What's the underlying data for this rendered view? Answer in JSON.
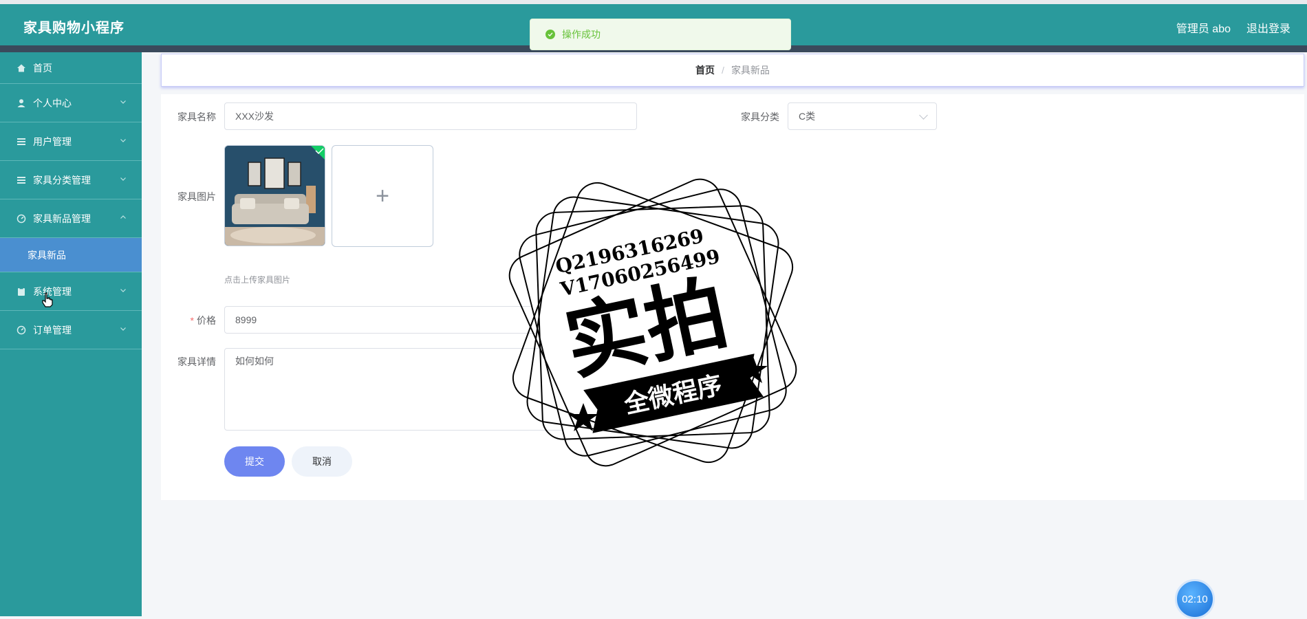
{
  "header": {
    "app_title": "家具购物小程序",
    "admin_label": "管理员 abo",
    "logout_label": "退出登录"
  },
  "toast": {
    "message": "操作成功",
    "color": "#67c23a"
  },
  "sidebar": {
    "items": [
      {
        "label": "首页",
        "icon": "home-icon"
      },
      {
        "label": "个人中心",
        "icon": "user-icon"
      },
      {
        "label": "用户管理",
        "icon": "list-icon"
      },
      {
        "label": "家具分类管理",
        "icon": "list-icon"
      },
      {
        "label": "家具新品管理",
        "icon": "gauge-icon",
        "expanded": true
      },
      {
        "label": "系统管理",
        "icon": "clipboard-icon"
      },
      {
        "label": "订单管理",
        "icon": "gauge-icon"
      }
    ],
    "submenu_active": "家具新品"
  },
  "breadcrumb": {
    "home": "首页",
    "separator": "/",
    "current": "家具新品"
  },
  "form": {
    "name_label": "家具名称",
    "name_value": "XXX沙发",
    "category_label": "家具分类",
    "category_value": "C类",
    "image_label": "家具图片",
    "upload_plus": "+",
    "upload_hint": "点击上传家具图片",
    "price_required": "*",
    "price_label": "价格",
    "price_value": "8999",
    "detail_label": "家具详情",
    "detail_value": "如何如何"
  },
  "buttons": {
    "submit": "提交",
    "cancel": "取消"
  },
  "timer": "02:10",
  "watermark": {
    "line1": "Q2196316269",
    "line2": "V17060256499",
    "main": "实拍",
    "ribbon": "全微程序"
  },
  "colors": {
    "header_bg": "#2a9a9c",
    "submenu_active_bg": "#4a8fd0",
    "submit_bg": "#6e86f0"
  }
}
